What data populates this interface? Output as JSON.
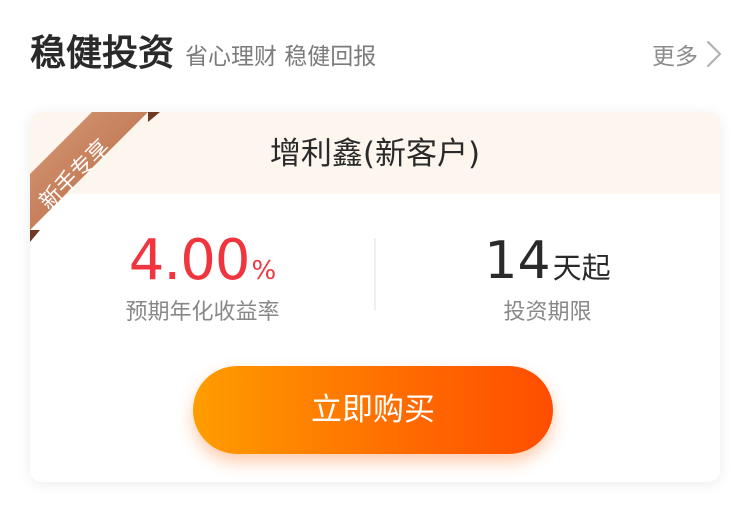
{
  "section": {
    "title": "稳健投资",
    "subtitle": "省心理财 稳健回报",
    "more_label": "更多"
  },
  "product": {
    "badge": "新手专享",
    "name": "增利鑫(新客户)",
    "rate": {
      "value": "4.00",
      "unit": "%",
      "label": "预期年化收益率"
    },
    "term": {
      "value": "14",
      "unit": "天起",
      "label": "投资期限"
    },
    "buy_label": "立即购买"
  },
  "colors": {
    "rate_red": "#f0353f",
    "button_start": "#ff9d00",
    "button_end": "#ff4d00",
    "ribbon": "#c57f5b",
    "card_head_bg": "#fdf6ef"
  },
  "icons": {
    "more": "chevron-right-icon"
  }
}
